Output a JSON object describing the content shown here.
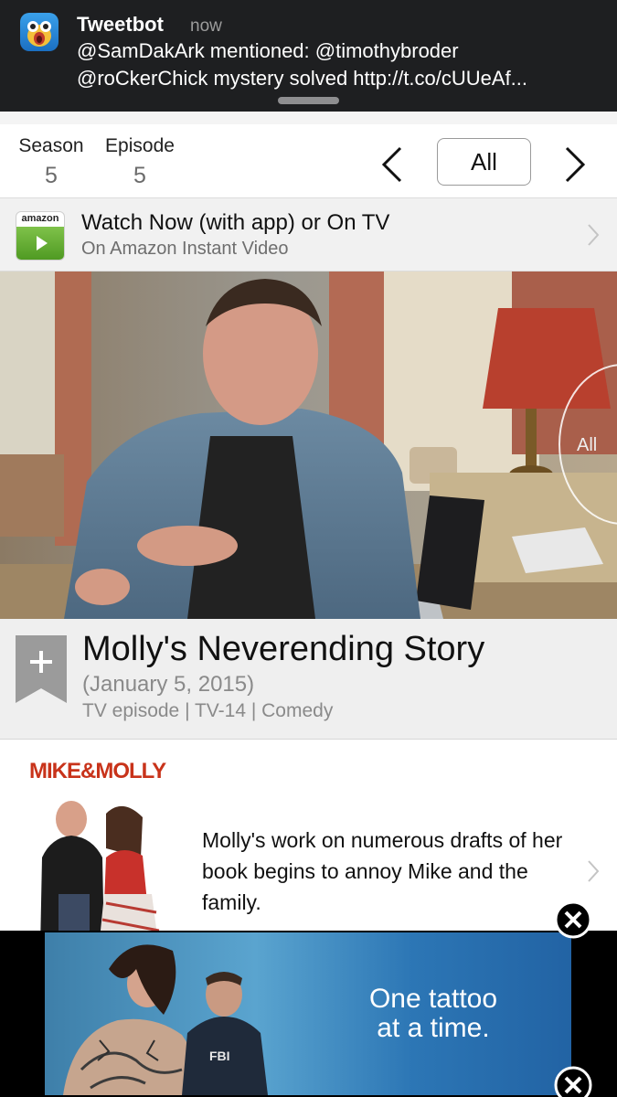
{
  "notification": {
    "app_name": "Tweetbot",
    "time": "now",
    "line1": "@SamDakArk mentioned: @timothybroder",
    "line2": "@roCkerChick mystery solved http://t.co/cUUeAf..."
  },
  "episode_nav": {
    "season_label": "Season",
    "season_value": "5",
    "episode_label": "Episode",
    "episode_value": "5",
    "all_label": "All"
  },
  "watch_row": {
    "badge_text": "amazon",
    "title": "Watch Now (with app) or On TV",
    "subtitle": "On Amazon Instant Video"
  },
  "scene": {
    "overlay_label": "All"
  },
  "episode": {
    "title": "Molly's Neverending Story",
    "date": "(January 5, 2015)",
    "meta": "TV episode | TV-14 | Comedy"
  },
  "description": {
    "poster_logo": "MIKE&MOLLY",
    "text": "Molly's work on numerous drafts of her book begins to annoy Mike and the family."
  },
  "ad": {
    "text_line1": "One tattoo",
    "text_line2": "at a time."
  },
  "icons": {
    "app": "tweetbot-bird-icon",
    "prev": "chevron-left-icon",
    "next": "chevron-right-icon",
    "row_more": "chevron-right-icon",
    "bookmark": "plus-bookmark-icon",
    "close": "close-circle-icon"
  }
}
